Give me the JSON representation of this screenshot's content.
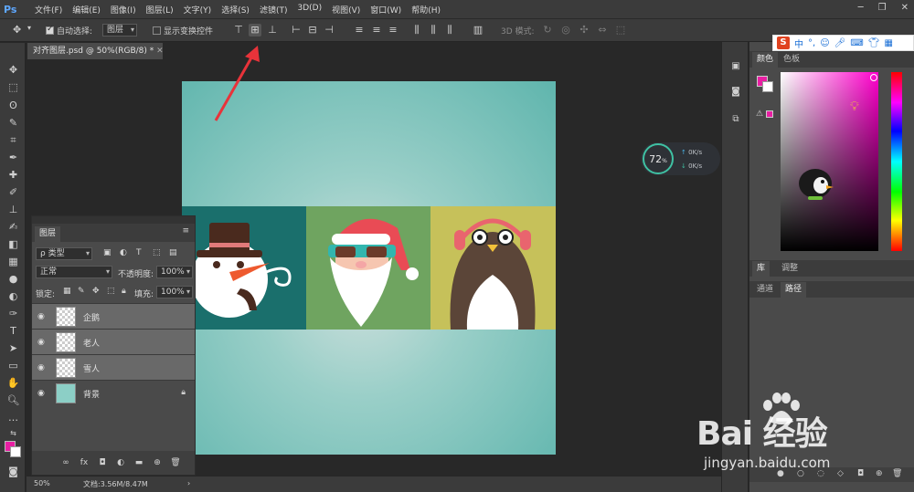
{
  "app": {
    "logo": "Ps"
  },
  "menu": [
    "文件(F)",
    "编辑(E)",
    "图像(I)",
    "图层(L)",
    "文字(Y)",
    "选择(S)",
    "滤镜(T)",
    "3D(D)",
    "视图(V)",
    "窗口(W)",
    "帮助(H)"
  ],
  "window_controls": [
    "─",
    "❐",
    "✕"
  ],
  "options": {
    "auto_select_label": "自动选择:",
    "auto_select_value": "图层",
    "show_transform_label": "显示变换控件",
    "mode_3d_label": "3D 模式:"
  },
  "document_tab": "对齐图层.psd @ 50%(RGB/8) *",
  "layers_panel": {
    "tab": "图层",
    "filter_label": "ρ 类型",
    "blend_mode": "正常",
    "opacity_label": "不透明度:",
    "opacity_value": "100%",
    "lock_label": "锁定:",
    "fill_label": "填充:",
    "fill_value": "100%",
    "layers": [
      {
        "name": "企鹅",
        "selected": true
      },
      {
        "name": "老人",
        "selected": true
      },
      {
        "name": "雪人",
        "selected": true
      },
      {
        "name": "背景",
        "selected": false,
        "locked": true
      }
    ]
  },
  "right_panel": {
    "tabs_top": [
      "颜色",
      "色板"
    ],
    "tabs_mid": [
      "库",
      "调整"
    ],
    "tabs_bottom": [
      "通道",
      "路径"
    ],
    "fg_color": "#e81fa3"
  },
  "status": {
    "zoom": "50%",
    "doc_info": "文档:3.56M/8.47M"
  },
  "net_widget": {
    "percent": "72",
    "percent_unit": "%",
    "up": "0K/s",
    "down": "0K/s"
  },
  "sogou": {
    "lang": "中"
  },
  "watermark": {
    "brand": "Bai 经验",
    "url": "jingyan.baidu.com"
  },
  "colors": {
    "tile_snow": "#1a6f6c",
    "tile_santa": "#6fa460",
    "tile_peng": "#c6c15a",
    "arrow": "#e8333a"
  }
}
